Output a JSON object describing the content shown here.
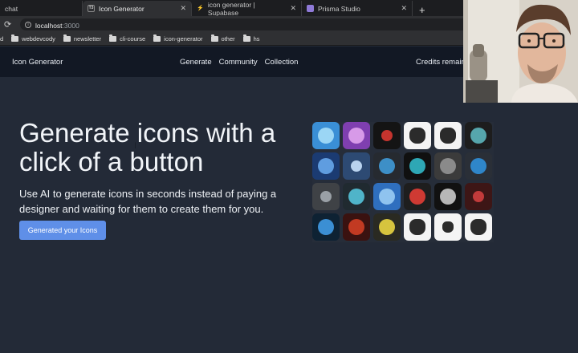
{
  "browser": {
    "tabs": [
      {
        "title": "chat",
        "active": false
      },
      {
        "title": "Icon Generator",
        "active": true,
        "favicon": "T3"
      },
      {
        "title": "icon generator | Supabase",
        "active": false
      },
      {
        "title": "Prisma Studio",
        "active": false
      }
    ],
    "url_host": "localhost",
    "url_port": ":3000",
    "bookmarks": [
      {
        "label": "d"
      },
      {
        "label": "webdevcody"
      },
      {
        "label": "newsletter"
      },
      {
        "label": "cli-course"
      },
      {
        "label": "icon-generator"
      },
      {
        "label": "other"
      },
      {
        "label": "hs"
      }
    ]
  },
  "app": {
    "brand": "Icon Generator",
    "nav": [
      "Generate",
      "Community",
      "Collection"
    ],
    "credits_label": "Credits remain",
    "hero_title": "Generate icons with a click of a button",
    "hero_subtitle": "Use AI to generate icons in seconds instead of paying a designer and waiting for them to create them for you.",
    "cta_label": "Generated your Icons"
  },
  "icon_grid": {
    "cells": [
      {
        "name": "blue-avatar-icon",
        "bg": "#3a8fd6",
        "fg": "#9bd6f5"
      },
      {
        "name": "purple-avatar-icon",
        "bg": "#7f3fb0",
        "fg": "#d79ae8"
      },
      {
        "name": "red-button-icon",
        "bg": "#141414",
        "fg": "#c4342e"
      },
      {
        "name": "glasses-man-icon",
        "bg": "#f4f4f4",
        "fg": "#2b2b2b"
      },
      {
        "name": "bearded-man-icon",
        "bg": "#f4f4f4",
        "fg": "#2b2b2b"
      },
      {
        "name": "teal-helmet-icon",
        "bg": "#1d1d1d",
        "fg": "#56a6ac"
      },
      {
        "name": "globe-icon",
        "bg": "#1b3b72",
        "fg": "#5f9de0"
      },
      {
        "name": "rocket-icon",
        "bg": "#2d4a73",
        "fg": "#b9d3ef"
      },
      {
        "name": "planet-icon",
        "bg": "#262a30",
        "fg": "#3d8fc7"
      },
      {
        "name": "code-squad-icon",
        "bg": "#101010",
        "fg": "#2ea7b5"
      },
      {
        "name": "gray-button-icon",
        "bg": "#3b3b3b",
        "fg": "#8a8a8a"
      },
      {
        "name": "jss-icon",
        "bg": "#2a2f37",
        "fg": "#2f86c9"
      },
      {
        "name": "letter-j-icon",
        "bg": "#3f4246",
        "fg": "#9aa0a6"
      },
      {
        "name": "ninja-icon",
        "bg": "#202a30",
        "fg": "#4fb4c9"
      },
      {
        "name": "bd-icon",
        "bg": "#2f6fbf",
        "fg": "#8fc3ef"
      },
      {
        "name": "red-robot-icon",
        "bg": "#1e1e1e",
        "fg": "#cf3a33"
      },
      {
        "name": "webtype-icon",
        "bg": "#111111",
        "fg": "#b7b7b7"
      },
      {
        "name": "red-logo-icon",
        "bg": "#3d1616",
        "fg": "#c23b3b"
      },
      {
        "name": "blue-orb-icon",
        "bg": "#0e2233",
        "fg": "#3b8fd4"
      },
      {
        "name": "red-cauldron-icon",
        "bg": "#3a1210",
        "fg": "#c23a22"
      },
      {
        "name": "yellow-face-icon",
        "bg": "#2a2a22",
        "fg": "#d6c43e"
      },
      {
        "name": "phone-man-icon",
        "bg": "#f4f4f4",
        "fg": "#2b2b2b"
      },
      {
        "name": "curly-hair-icon",
        "bg": "#f4f4f4",
        "fg": "#2b2b2b"
      },
      {
        "name": "man-portrait-icon",
        "bg": "#f4f4f4",
        "fg": "#2b2b2b"
      }
    ]
  },
  "colors": {
    "page_bg": "#232a37",
    "nav_bg": "#121824",
    "cta_bg": "#5f8fe8"
  }
}
